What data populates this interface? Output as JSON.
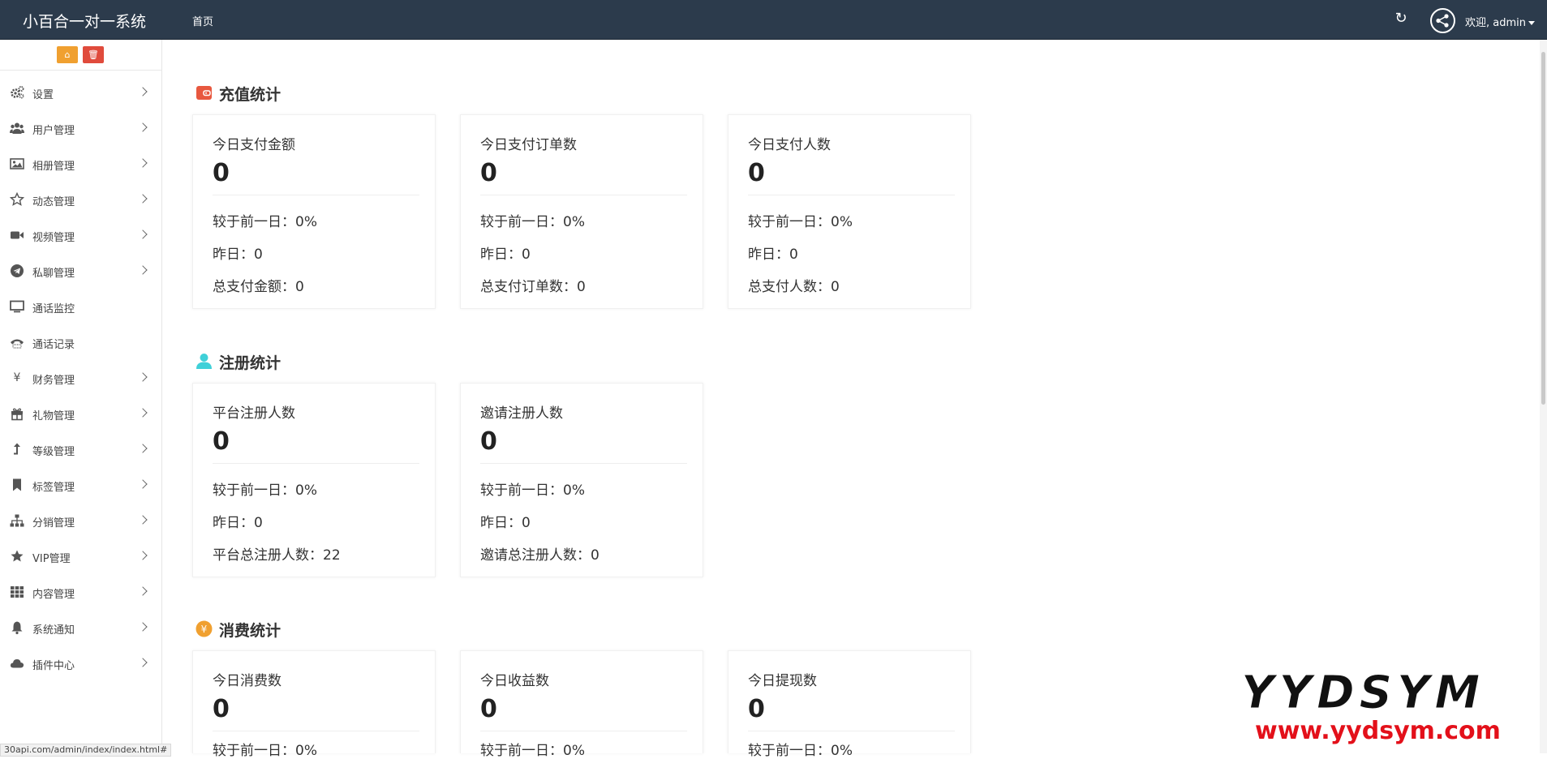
{
  "header": {
    "brand": "小百合一对一系统",
    "nav_home": "首页",
    "welcome": "欢迎, admin"
  },
  "sidebar": {
    "items": [
      {
        "label": "设置",
        "icon": "gears-icon",
        "has_submenu": true
      },
      {
        "label": "用户管理",
        "icon": "users-icon",
        "has_submenu": true
      },
      {
        "label": "相册管理",
        "icon": "image-icon",
        "has_submenu": true
      },
      {
        "label": "动态管理",
        "icon": "star-outline-icon",
        "has_submenu": true
      },
      {
        "label": "视频管理",
        "icon": "video-camera-icon",
        "has_submenu": true
      },
      {
        "label": "私聊管理",
        "icon": "telegram-icon",
        "has_submenu": true
      },
      {
        "label": "通话监控",
        "icon": "monitor-icon",
        "has_submenu": false
      },
      {
        "label": "通话记录",
        "icon": "phone-icon",
        "has_submenu": false
      },
      {
        "label": "财务管理",
        "icon": "yen-icon",
        "has_submenu": true
      },
      {
        "label": "礼物管理",
        "icon": "gift-icon",
        "has_submenu": true
      },
      {
        "label": "等级管理",
        "icon": "level-up-icon",
        "has_submenu": true
      },
      {
        "label": "标签管理",
        "icon": "bookmark-icon",
        "has_submenu": true
      },
      {
        "label": "分销管理",
        "icon": "sitemap-icon",
        "has_submenu": true
      },
      {
        "label": "VIP管理",
        "icon": "star-icon",
        "has_submenu": true
      },
      {
        "label": "内容管理",
        "icon": "grid-icon",
        "has_submenu": true
      },
      {
        "label": "系统通知",
        "icon": "bell-icon",
        "has_submenu": true
      },
      {
        "label": "插件中心",
        "icon": "cloud-icon",
        "has_submenu": true
      }
    ]
  },
  "sections": {
    "recharge": {
      "title": "充值统计",
      "cards": [
        {
          "title": "今日支付金额",
          "value": "0",
          "compare": "较于前一日：0%",
          "yesterday": "昨日：0",
          "total": "总支付金额：0"
        },
        {
          "title": "今日支付订单数",
          "value": "0",
          "compare": "较于前一日：0%",
          "yesterday": "昨日：0",
          "total": "总支付订单数：0"
        },
        {
          "title": "今日支付人数",
          "value": "0",
          "compare": "较于前一日：0%",
          "yesterday": "昨日：0",
          "total": "总支付人数：0"
        }
      ]
    },
    "register": {
      "title": "注册统计",
      "cards": [
        {
          "title": "平台注册人数",
          "value": "0",
          "compare": "较于前一日：0%",
          "yesterday": "昨日：0",
          "total": "平台总注册人数：22"
        },
        {
          "title": "邀请注册人数",
          "value": "0",
          "compare": "较于前一日：0%",
          "yesterday": "昨日：0",
          "total": "邀请总注册人数：0"
        }
      ]
    },
    "consume": {
      "title": "消费统计",
      "cards": [
        {
          "title": "今日消费数",
          "value": "0",
          "compare": "较于前一日：0%"
        },
        {
          "title": "今日收益数",
          "value": "0",
          "compare": "较于前一日：0%"
        },
        {
          "title": "今日提现数",
          "value": "0",
          "compare": "较于前一日：0%"
        }
      ]
    }
  },
  "watermark": {
    "line1": "YYDSYM",
    "line2": "www.yydsym.com"
  },
  "statusbar": {
    "url": "30api.com/admin/index/index.html#"
  },
  "colors": {
    "topbar": "#2c3b4c",
    "home_button": "#f0a030",
    "trash_button": "#e04b3c",
    "recharge_icon": "#e8583f",
    "register_icon": "#3fd0d8",
    "consume_icon": "#f0a030"
  }
}
